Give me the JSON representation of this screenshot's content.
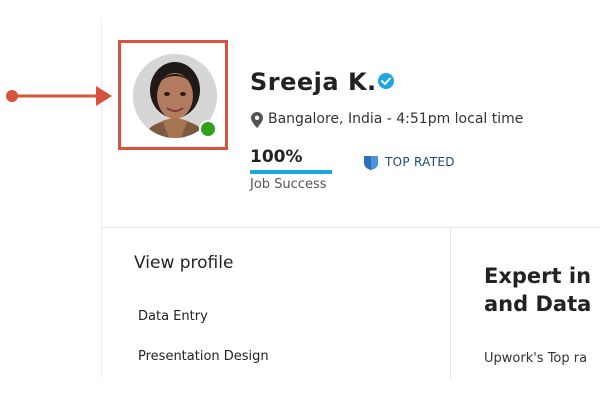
{
  "profile": {
    "name": "Sreeja K.",
    "location": "Bangalore, India - 4:51pm local time",
    "job_success_value": "100%",
    "job_success_fraction": 1.0,
    "job_success_label": "Job Success",
    "badge": "TOP RATED",
    "online": true
  },
  "sidebar": {
    "view_profile": "View profile",
    "skills": [
      "Data Entry",
      "Presentation Design"
    ]
  },
  "main": {
    "title_line1": "Expert in",
    "title_line2": "and Data",
    "text": "Upwork's Top ra"
  },
  "colors": {
    "annotation": "#d9533c",
    "online": "#2fa318",
    "verified": "#1ca7e0",
    "progress": "#1ca7e0",
    "badge": "#1a4b7a"
  },
  "icons": {
    "verified": "verified-check-icon",
    "location": "map-pin-icon",
    "badge": "shield-badge-icon",
    "arrow": "arrow-right-icon"
  }
}
